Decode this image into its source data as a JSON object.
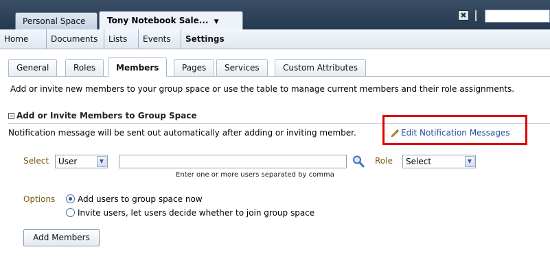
{
  "top_tabs": {
    "personal": "Personal Space",
    "current": "Tony Notebook Sale...",
    "current_caret": "▼"
  },
  "close_icon": "✖",
  "nav": {
    "items": [
      "Home",
      "Documents",
      "Lists",
      "Events",
      "Settings"
    ],
    "active": "Settings"
  },
  "subtabs": {
    "items": [
      "General",
      "Roles",
      "Members",
      "Pages",
      "Services",
      "Custom Attributes"
    ],
    "active": "Members"
  },
  "intro_text": "Add or invite new members to your group space or use the table to manage current members and their role assignments.",
  "section": {
    "title": "Add or Invite Members to Group Space",
    "notification_text": "Notification message will be sent out automatically after adding or inviting member.",
    "edit_link": "Edit Notification Messages"
  },
  "form": {
    "select_label": "Select",
    "select_value": "User",
    "user_input_value": "",
    "hint": "Enter one or more users separated by comma",
    "role_label": "Role",
    "role_value": "Select",
    "options_label": "Options",
    "option_add": "Add users to group space now",
    "option_invite": "Invite users, let users decide whether to join group space",
    "selected_option": "add",
    "add_button": "Add Members"
  },
  "icons": {
    "edit": "pencil-icon",
    "search": "magnifier-icon",
    "dropdown": "chevron-down-icon"
  },
  "colors": {
    "highlight": "#e00000",
    "link": "#1c4fa0",
    "label": "#7a5a0f",
    "header_bg": "#24384f"
  }
}
